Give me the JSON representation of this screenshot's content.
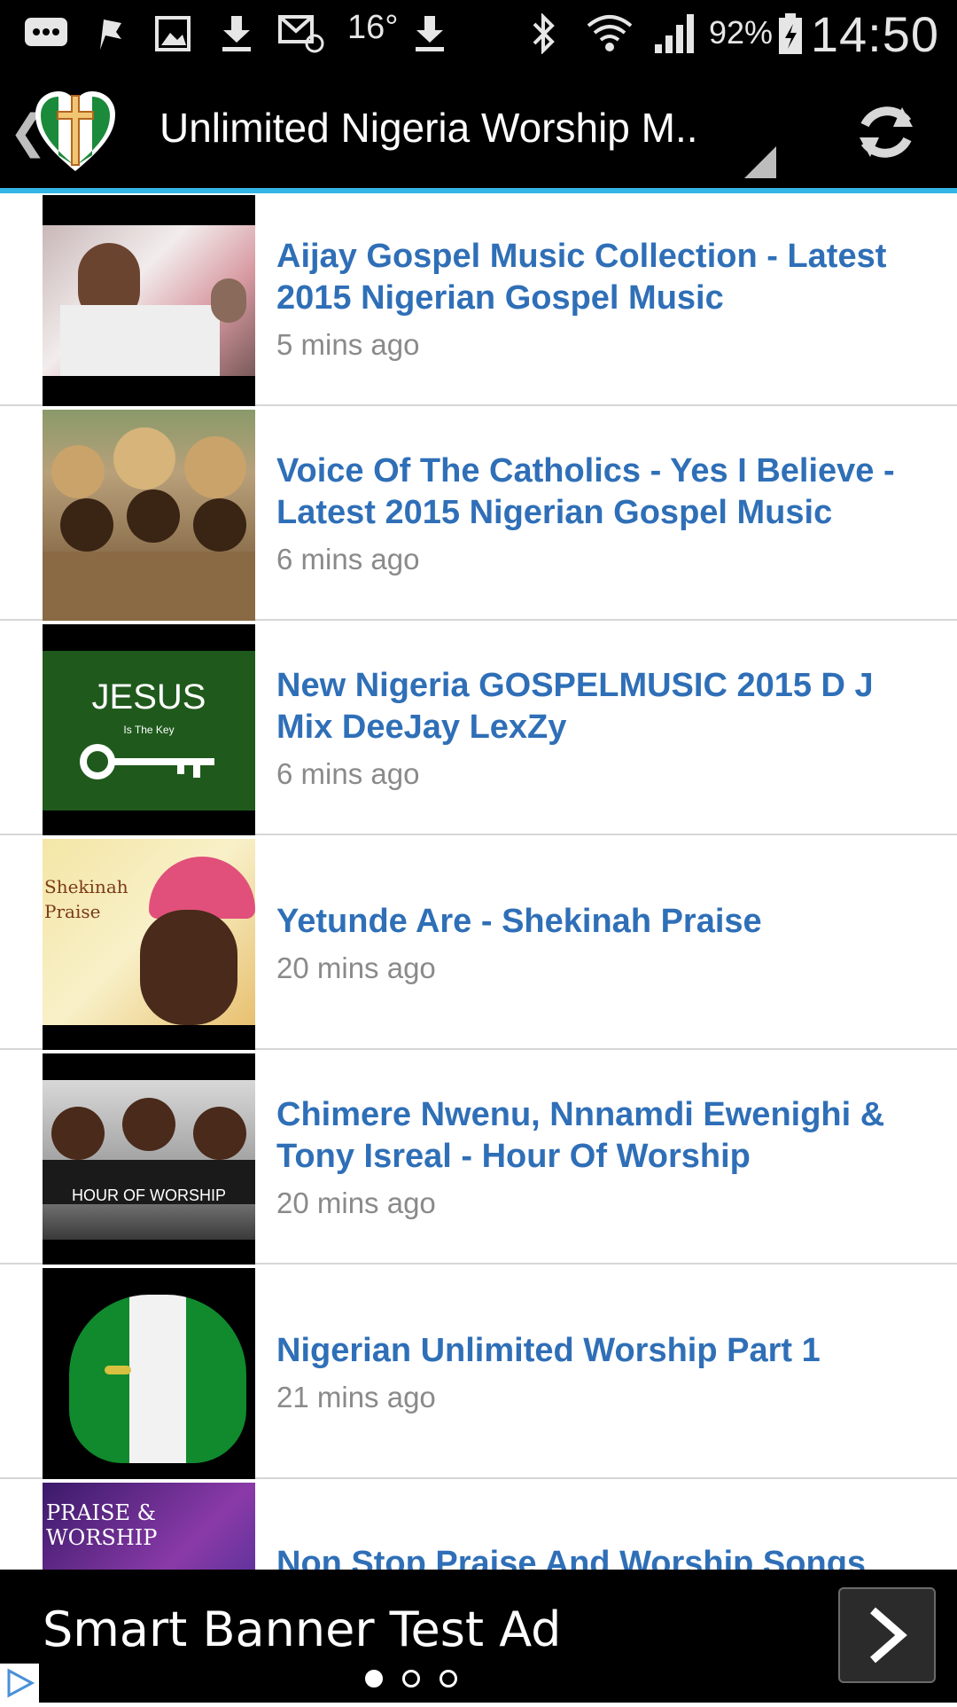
{
  "status_bar": {
    "temperature": "16°",
    "battery": "92%",
    "time": "14:50"
  },
  "action_bar": {
    "title": "Unlimited Nigeria Worship M..",
    "accent_color": "#33b5e5"
  },
  "list": {
    "title_color": "#2f6fb7",
    "items": [
      {
        "title": "Aijay Gospel Music Collection - Latest 2015 Nigerian Gospel Music",
        "time": "5 mins ago"
      },
      {
        "title": "Voice Of The Catholics - Yes I Believe - Latest 2015 Nigerian Gospel Music",
        "time": "6 mins ago"
      },
      {
        "title": "New Nigeria GOSPELMUSIC 2015 D J Mix DeeJay LexZy",
        "time": "6 mins ago",
        "thumb_text": "JESUS",
        "thumb_subtext": "Is The Key"
      },
      {
        "title": "Yetunde Are - Shekinah Praise",
        "time": "20 mins ago",
        "thumb_text": "Shekinah Praise"
      },
      {
        "title": "Chimere Nwenu, Nnnamdi Ewenighi & Tony Isreal - Hour Of Worship",
        "time": "20 mins ago",
        "thumb_text": "HOUR OF WORSHIP"
      },
      {
        "title": "Nigerian Unlimited Worship Part 1",
        "time": "21 mins ago"
      },
      {
        "title": "Non Stop Praise And Worship Songs",
        "time": "",
        "thumb_text": "PRAISE & WORSHIP"
      }
    ]
  },
  "ad": {
    "text": "Smart Banner Test Ad",
    "pages": 3,
    "active_page": 1
  }
}
